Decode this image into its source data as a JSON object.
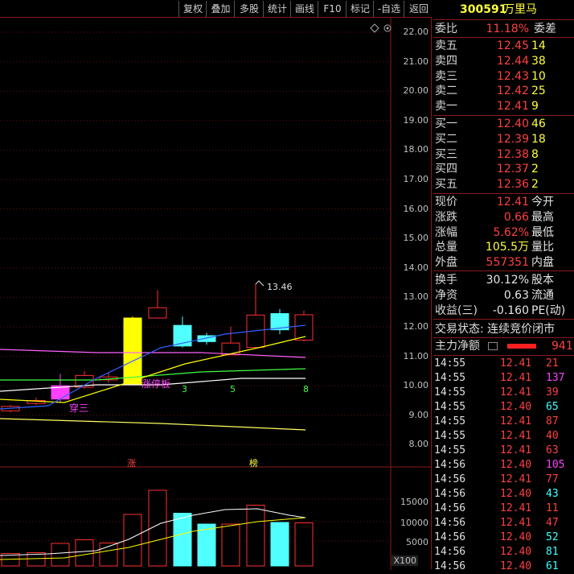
{
  "toolbar": [
    "复权",
    "叠加",
    "多股",
    "统计",
    "画线",
    "F10",
    "标记",
    "-自选",
    "返回"
  ],
  "price_axis": [
    "22.00",
    "21.00",
    "20.00",
    "19.00",
    "18.00",
    "17.00",
    "16.00",
    "15.00",
    "14.00",
    "13.00",
    "12.00",
    "11.00",
    "10.00",
    "9.00",
    "8.00"
  ],
  "volume_axis": [
    "15000",
    "10000",
    "5000"
  ],
  "volume_unit": "X100",
  "annotations": {
    "high": "13.46",
    "limit_up": "涨停板",
    "chuan_san": "穿三",
    "count_3": "3",
    "count_5": "5",
    "count_8": "8",
    "zhang_marker": "涨",
    "bang_marker": "榜"
  },
  "quote": {
    "code": "300591",
    "name": "万里马",
    "weibi_label": "委比",
    "weibi_value": "11.18%",
    "weicha_label": "委差",
    "asks": [
      {
        "label": "卖五",
        "price": "12.45",
        "vol": "14"
      },
      {
        "label": "卖四",
        "price": "12.44",
        "vol": "38"
      },
      {
        "label": "卖三",
        "price": "12.43",
        "vol": "10"
      },
      {
        "label": "卖二",
        "price": "12.42",
        "vol": "25"
      },
      {
        "label": "卖一",
        "price": "12.41",
        "vol": "9"
      }
    ],
    "bids": [
      {
        "label": "买一",
        "price": "12.40",
        "vol": "46"
      },
      {
        "label": "买二",
        "price": "12.39",
        "vol": "18"
      },
      {
        "label": "买三",
        "price": "12.38",
        "vol": "8"
      },
      {
        "label": "买四",
        "price": "12.37",
        "vol": "2"
      },
      {
        "label": "买五",
        "price": "12.36",
        "vol": "2"
      }
    ],
    "stats": [
      {
        "label": "现价",
        "value": "12.41",
        "right": "今开",
        "color": "red"
      },
      {
        "label": "涨跌",
        "value": "0.66",
        "right": "最高",
        "color": "red"
      },
      {
        "label": "涨幅",
        "value": "5.62%",
        "right": "最低",
        "color": "red"
      },
      {
        "label": "总量",
        "value": "105.5万",
        "right": "量比",
        "color": "yel"
      },
      {
        "label": "外盘",
        "value": "557351",
        "right": "内盘",
        "color": "red"
      }
    ],
    "fund": [
      {
        "label": "换手",
        "value": "30.12%",
        "right": "股本"
      },
      {
        "label": "净资",
        "value": "0.63",
        "right": "流通"
      },
      {
        "label": "收益(三)",
        "value": "-0.160",
        "right": "PE(动)"
      }
    ],
    "trade_status": "交易状态: 连续竞价闭市",
    "main_net_label": "主力净额",
    "main_net_value": "941"
  },
  "ticks": [
    {
      "time": "14:55",
      "price": "12.41",
      "vol": "21",
      "color": "red"
    },
    {
      "time": "14:55",
      "price": "12.41",
      "vol": "137",
      "color": "mag"
    },
    {
      "time": "14:55",
      "price": "12.41",
      "vol": "39",
      "color": "red"
    },
    {
      "time": "14:55",
      "price": "12.40",
      "vol": "65",
      "color": "cyan"
    },
    {
      "time": "14:55",
      "price": "12.41",
      "vol": "87",
      "color": "red"
    },
    {
      "time": "14:55",
      "price": "12.41",
      "vol": "40",
      "color": "red"
    },
    {
      "time": "14:55",
      "price": "12.41",
      "vol": "63",
      "color": "red"
    },
    {
      "time": "14:56",
      "price": "12.40",
      "vol": "105",
      "color": "mag"
    },
    {
      "time": "14:56",
      "price": "12.41",
      "vol": "77",
      "color": "red"
    },
    {
      "time": "14:56",
      "price": "12.40",
      "vol": "43",
      "color": "cyan"
    },
    {
      "time": "14:56",
      "price": "12.41",
      "vol": "11",
      "color": "red"
    },
    {
      "time": "14:56",
      "price": "12.41",
      "vol": "47",
      "color": "red"
    },
    {
      "time": "14:56",
      "price": "12.40",
      "vol": "52",
      "color": "cyan"
    },
    {
      "time": "14:56",
      "price": "12.40",
      "vol": "81",
      "color": "cyan"
    },
    {
      "time": "14:56",
      "price": "12.40",
      "vol": "61",
      "color": "cyan"
    }
  ],
  "chart_data": {
    "type": "candlestick",
    "ylim": [
      7.6,
      22.3
    ],
    "candles": [
      {
        "open": 9.15,
        "close": 9.3,
        "high": 9.35,
        "low": 9.1,
        "color": "red"
      },
      {
        "open": 9.4,
        "close": 9.5,
        "high": 9.6,
        "low": 9.35,
        "color": "red"
      },
      {
        "open": 9.55,
        "close": 10.0,
        "high": 10.4,
        "low": 9.45,
        "color": "mag"
      },
      {
        "open": 9.95,
        "close": 10.35,
        "high": 10.5,
        "low": 9.9,
        "color": "red"
      },
      {
        "open": 10.2,
        "close": 10.3,
        "high": 10.45,
        "low": 10.1,
        "color": "red"
      },
      {
        "open": 10.05,
        "close": 12.3,
        "high": 12.35,
        "low": 10.05,
        "color": "yel"
      },
      {
        "open": 12.3,
        "close": 12.65,
        "high": 13.25,
        "low": 12.3,
        "color": "red"
      },
      {
        "open": 12.05,
        "close": 11.35,
        "high": 12.35,
        "low": 11.3,
        "color": "cyan"
      },
      {
        "open": 11.7,
        "close": 11.5,
        "high": 11.8,
        "low": 11.4,
        "color": "cyan"
      },
      {
        "open": 11.05,
        "close": 11.45,
        "high": 12.0,
        "low": 11.05,
        "color": "red"
      },
      {
        "open": 11.3,
        "close": 12.4,
        "high": 13.46,
        "low": 11.3,
        "color": "red"
      },
      {
        "open": 12.45,
        "close": 11.9,
        "high": 12.6,
        "low": 11.75,
        "color": "cyan"
      },
      {
        "open": 11.55,
        "close": 12.41,
        "high": 12.55,
        "low": 11.5,
        "color": "red"
      }
    ],
    "volume_ylim": [
      0,
      20000
    ],
    "volumes": [
      {
        "v": 3100,
        "color": "red"
      },
      {
        "v": 3300,
        "color": "red"
      },
      {
        "v": 5600,
        "color": "red"
      },
      {
        "v": 6500,
        "color": "red"
      },
      {
        "v": 5700,
        "color": "red"
      },
      {
        "v": 12800,
        "color": "red"
      },
      {
        "v": 18800,
        "color": "red"
      },
      {
        "v": 13100,
        "color": "cyan"
      },
      {
        "v": 10400,
        "color": "cyan"
      },
      {
        "v": 10400,
        "color": "red"
      },
      {
        "v": 15100,
        "color": "red"
      },
      {
        "v": 10800,
        "color": "cyan"
      },
      {
        "v": 10700,
        "color": "red"
      }
    ]
  }
}
